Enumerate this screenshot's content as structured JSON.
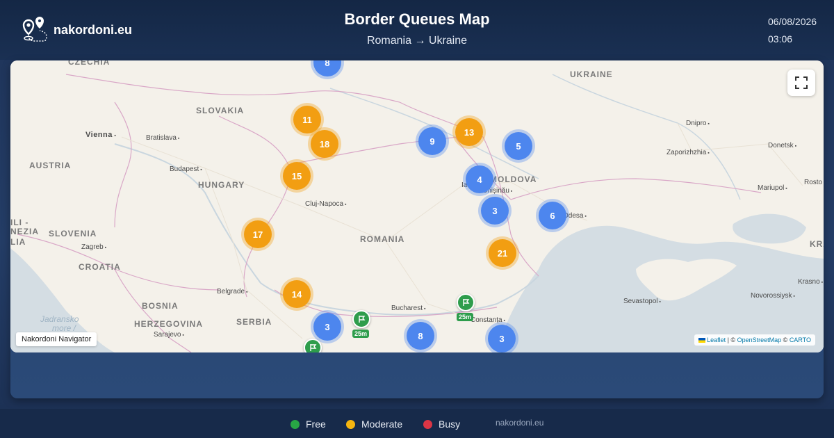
{
  "header": {
    "brand": "nakordoni.eu",
    "title": "Border Queues Map",
    "route_from": "Romania",
    "route_arrow": "→",
    "route_to": "Ukraine",
    "date": "06/08/2026",
    "time": "03:06"
  },
  "map": {
    "countries": [
      "CZECHIA",
      "SLOVAKIA",
      "AUSTRIA",
      "HUNGARY",
      "UKRAINE",
      "MOLDOVA",
      "ROMANIA",
      "SLOVENIA",
      "CROATIA",
      "BOSNIA",
      "HERZEGOVINA",
      "SERBIA",
      "ILI -",
      "NEZIA",
      "LIA",
      "KRA"
    ],
    "cities": [
      "Vienna",
      "Bratislava",
      "Budapest",
      "Cluj-Napoca",
      "Dnipro",
      "Zaporizhzhia",
      "Donetsk",
      "Mariupol",
      "Rosto",
      "Chișinău",
      "Iaș",
      "Odesa",
      "Zagreb",
      "Belgrade",
      "Sarajevo",
      "Bucharest",
      "Constanța",
      "Sevastopol",
      "Novorossiysk",
      "Krasno"
    ],
    "sea_labels": [
      "Jadransko",
      "more /"
    ],
    "clusters": [
      {
        "count": "8",
        "status": "blue"
      },
      {
        "count": "11",
        "status": "orange"
      },
      {
        "count": "18",
        "status": "orange"
      },
      {
        "count": "15",
        "status": "orange"
      },
      {
        "count": "17",
        "status": "orange"
      },
      {
        "count": "14",
        "status": "orange"
      },
      {
        "count": "9",
        "status": "blue"
      },
      {
        "count": "13",
        "status": "orange"
      },
      {
        "count": "5",
        "status": "blue"
      },
      {
        "count": "4",
        "status": "blue"
      },
      {
        "count": "3",
        "status": "blue"
      },
      {
        "count": "6",
        "status": "blue"
      },
      {
        "count": "21",
        "status": "orange"
      },
      {
        "count": "3",
        "status": "blue"
      },
      {
        "count": "8",
        "status": "blue"
      },
      {
        "count": "3",
        "status": "blue"
      }
    ],
    "pins": [
      {
        "tag": "25m"
      },
      {
        "tag": "25m"
      },
      {
        "tag": ""
      }
    ],
    "navigator_label": "Nakordoni Navigator",
    "attribution": {
      "leaflet": "Leaflet",
      "sep1": " | © ",
      "osm": "OpenStreetMap",
      "sep2": " © ",
      "carto": "CARTO"
    }
  },
  "legend": {
    "items": [
      {
        "label": "Free",
        "color": "#28a745"
      },
      {
        "label": "Moderate",
        "color": "#f5b50f"
      },
      {
        "label": "Busy",
        "color": "#dc3545"
      }
    ],
    "site": "nakordoni.eu"
  },
  "colors": {
    "cluster_blue": "#4d86ee",
    "cluster_orange": "#f29e12",
    "pin_green": "#2e9d4c"
  }
}
